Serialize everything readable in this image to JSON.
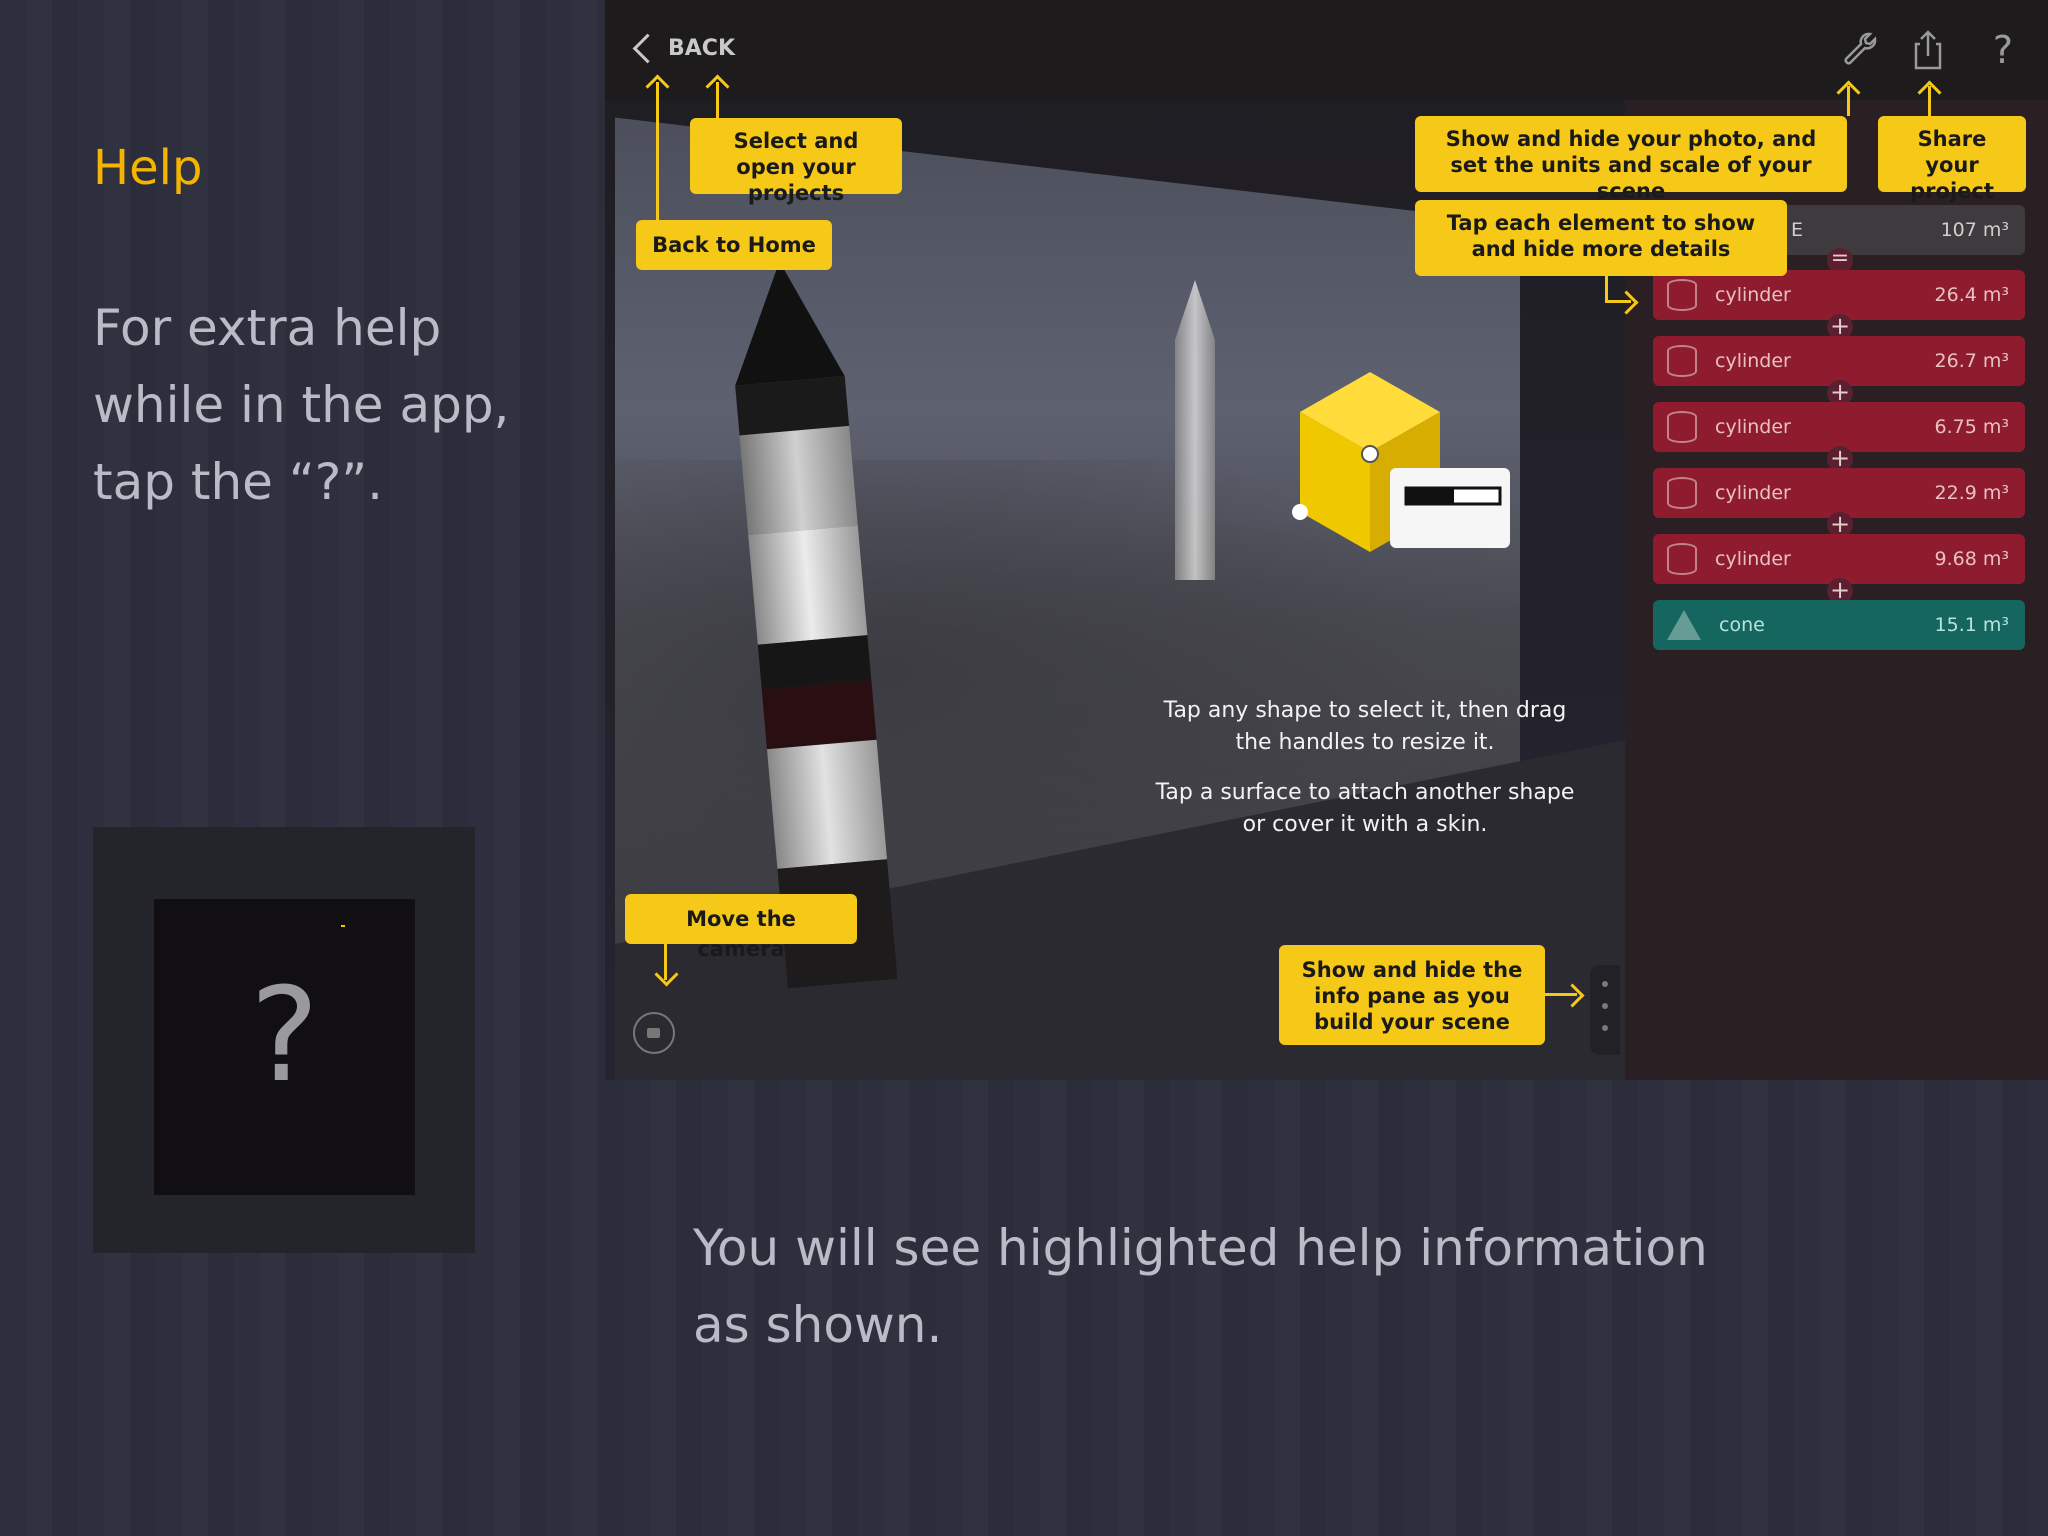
{
  "slide": {
    "title": "Help",
    "body": "For extra help\nwhile in the app,\ntap the “?”.",
    "help_button_symbol": "?",
    "caption": "You will see highlighted help information\nas shown."
  },
  "app": {
    "back_label": "BACK",
    "toolbar_icons": [
      "wrench-icon",
      "share-icon",
      "help-icon"
    ],
    "help_icon_symbol": "?",
    "center_help": [
      "Tap any shape to select it, then drag the handles to resize it.",
      "Tap a surface to attach another shape or cover it with a skin."
    ],
    "summary_row": {
      "label": "E",
      "value": "107 m³"
    },
    "elements": [
      {
        "label": "cylinder",
        "value": "26.4 m³",
        "kind": "cylinder"
      },
      {
        "label": "cylinder",
        "value": "26.7 m³",
        "kind": "cylinder"
      },
      {
        "label": "cylinder",
        "value": "6.75 m³",
        "kind": "cylinder"
      },
      {
        "label": "cylinder",
        "value": "22.9 m³",
        "kind": "cylinder"
      },
      {
        "label": "cylinder",
        "value": "9.68 m³",
        "kind": "cylinder"
      },
      {
        "label": "cone",
        "value": "15.1 m³",
        "kind": "cone"
      }
    ],
    "callouts": {
      "select_projects": "Select and open your projects",
      "back_home": "Back to Home",
      "show_photo": "Show and hide your photo, and set the units and scale of your scene",
      "share": "Share your project",
      "tap_element": "Tap each element to show and hide more details",
      "move_camera": "Move the camera",
      "info_pane": "Show and hide the info pane as you build your scene"
    }
  },
  "colors": {
    "accent": "#f5b400",
    "callout": "#f6c817",
    "cylinder_row": "#8e1c2e",
    "cone_row": "#14665f"
  }
}
